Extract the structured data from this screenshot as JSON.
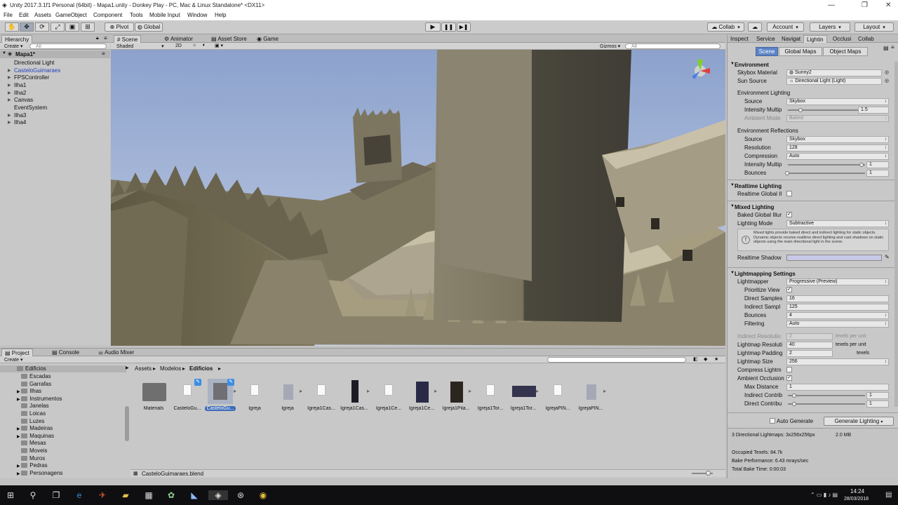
{
  "window": {
    "title": "Unity 2017.3.1f1 Personal (64bit) - Mapa1.unity - Donkey Play - PC, Mac & Linux Standalone* <DX11>"
  },
  "menu": [
    "File",
    "Edit",
    "Assets",
    "GameObject",
    "Component",
    "Tools",
    "Mobile Input",
    "Window",
    "Help"
  ],
  "toolbar": {
    "pivot": "Pivot",
    "global": "Global",
    "collab": "Collab",
    "account": "Account",
    "layers": "Layers",
    "layout": "Layout"
  },
  "hierarchy": {
    "tab": "Hierarchy",
    "create": "Create",
    "search_placeholder": "All",
    "scene": "Mapa1*",
    "items": [
      "Directional Light",
      "CasteloGuimaraes",
      "FPSController",
      "Ilha1",
      "Ilha2",
      "Canvas",
      "EventSystem",
      "Ilha3",
      "Ilha4"
    ]
  },
  "scene_tabs": {
    "scene": "Scene",
    "animator": "Animator",
    "asset_store": "Asset Store",
    "game": "Game"
  },
  "scene_bar": {
    "shaded": "Shaded",
    "mode2d": "2D",
    "gizmos": "Gizmos",
    "search_placeholder": "All"
  },
  "project": {
    "tabs": [
      "Project",
      "Console",
      "Audio Mixer"
    ],
    "create": "Create",
    "tree": [
      "Edificios",
      "Escadas",
      "Garrafas",
      "Ilhas",
      "Instrumentos",
      "Janelas",
      "Loicas",
      "Luzes",
      "Madeiras",
      "Maquinas",
      "Mesas",
      "Moveis",
      "Muros",
      "Pedras",
      "Personagens"
    ],
    "breadcrumb": [
      "Assets",
      "Modelos",
      "Edificios"
    ],
    "assets": [
      "Materials",
      "CasteloGu...",
      "CasteloGu...",
      "Igreja",
      "Igreja",
      "Igreja1Cas...",
      "Igreja1Cas...",
      "Igreja1Ce...",
      "Igreja1Ce...",
      "Igreja1Pila...",
      "Igreja1Tor...",
      "Igreja1Tor...",
      "IgrejaPIN...",
      "IgrejaPIN..."
    ],
    "status_file": "CasteloGuimaraes.blend"
  },
  "inspector": {
    "tabs": [
      "Inspect",
      "Service",
      "Navigat",
      "Lightin",
      "Occlusi",
      "Collab"
    ],
    "subtabs": [
      "Scene",
      "Global Maps",
      "Object Maps"
    ],
    "environment": {
      "header": "Environment",
      "skybox_label": "Skybox Material",
      "skybox_value": "Sunny2",
      "sun_label": "Sun Source",
      "sun_value": "Directional Light (Light)",
      "env_lighting": "Environment Lighting",
      "source_label": "Source",
      "source_value": "Skybox",
      "intensity_label": "Intensity Multip",
      "intensity_value": "1.5",
      "ambient_label": "Ambient Mode",
      "ambient_value": "Baked",
      "env_reflections": "Environment Reflections",
      "r_source_label": "Source",
      "r_source_value": "Skybox",
      "resolution_label": "Resolution",
      "resolution_value": "128",
      "compression_label": "Compression",
      "compression_value": "Auto",
      "r_intensity_label": "Intensity Multip",
      "r_intensity_value": "1",
      "bounces_label": "Bounces",
      "bounces_value": "1"
    },
    "realtime": {
      "header": "Realtime Lighting",
      "gi_label": "Realtime Global Il"
    },
    "mixed": {
      "header": "Mixed Lighting",
      "baked_label": "Baked Global Illur",
      "mode_label": "Lighting Mode",
      "mode_value": "Subtractive",
      "info": "Mixed lights provide baked direct and indirect lighting for static objects. Dynamic objects receive realtime direct lighting and cast shadows on static objects using the main directional light in the scene.",
      "shadow_label": "Realtime Shadow"
    },
    "lightmapping": {
      "header": "Lightmapping Settings",
      "lightmapper_label": "Lightmapper",
      "lightmapper_value": "Progressive (Preview)",
      "prioritize_label": "Prioritize View",
      "direct_label": "Direct Samples",
      "direct_value": "16",
      "indirect_label": "Indirect Sampl",
      "indirect_value": "125",
      "bounces_label": "Bounces",
      "bounces_value": "4",
      "filtering_label": "Filtering",
      "filtering_value": "Auto",
      "ind_res_label": "Indirect Resolutio",
      "ind_res_value": "2",
      "texels_per_unit": "texels per unit",
      "lm_res_label": "Lightmap Resoluti",
      "lm_res_value": "40",
      "padding_label": "Lightmap Padding",
      "padding_value": "2",
      "texels": "texels",
      "size_label": "Lightmap Size",
      "size_value": "256",
      "compress_label": "Compress Lightm",
      "ao_label": "Ambient Occlusion",
      "maxdist_label": "Max Distance",
      "maxdist_value": "1",
      "ind_contrib_label": "Indirect Contrib",
      "ind_contrib_value": "1",
      "dir_contrib_label": "Direct Contribu",
      "dir_contrib_value": "1"
    },
    "auto_generate": "Auto Generate",
    "generate_button": "Generate Lighting",
    "stats": {
      "lightmaps": "3 Directional Lightmaps: 3x256x256px",
      "mb": "2.0 MB",
      "occupied": "Occupied Texels: 84.7k",
      "performance": "Bake Performance: 6.43 mrays/sec",
      "total_time": "Total Bake Time: 0:00:03"
    }
  },
  "taskbar": {
    "time": "14:24",
    "date": "28/03/2018"
  },
  "colors": {
    "accent": "#3d6cb8",
    "sky": "#9fb4d8",
    "castle": "#8c8468",
    "taskbar": "#0f0f12"
  }
}
